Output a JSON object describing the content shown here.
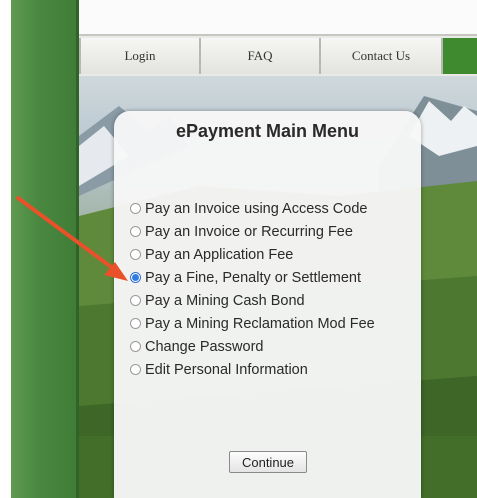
{
  "nav": {
    "login": "Login",
    "faq": "FAQ",
    "contact": "Contact Us"
  },
  "menu": {
    "title": "ePayment Main Menu",
    "options": [
      {
        "label": "Pay an Invoice using Access Code",
        "selected": false
      },
      {
        "label": "Pay an Invoice or Recurring Fee",
        "selected": false
      },
      {
        "label": "Pay an Application Fee",
        "selected": false
      },
      {
        "label": "Pay a Fine, Penalty or Settlement",
        "selected": true
      },
      {
        "label": "Pay a Mining Cash Bond",
        "selected": false
      },
      {
        "label": "Pay a Mining Reclamation Mod Fee",
        "selected": false
      },
      {
        "label": "Change Password",
        "selected": false
      },
      {
        "label": "Edit Personal Information",
        "selected": false
      }
    ],
    "continue_label": "Continue"
  },
  "colors": {
    "band_green": "#4a8840",
    "nav_green": "#3f8a2f",
    "selected_radio": "#2f7de0",
    "annotation_arrow": "#e8512a"
  }
}
